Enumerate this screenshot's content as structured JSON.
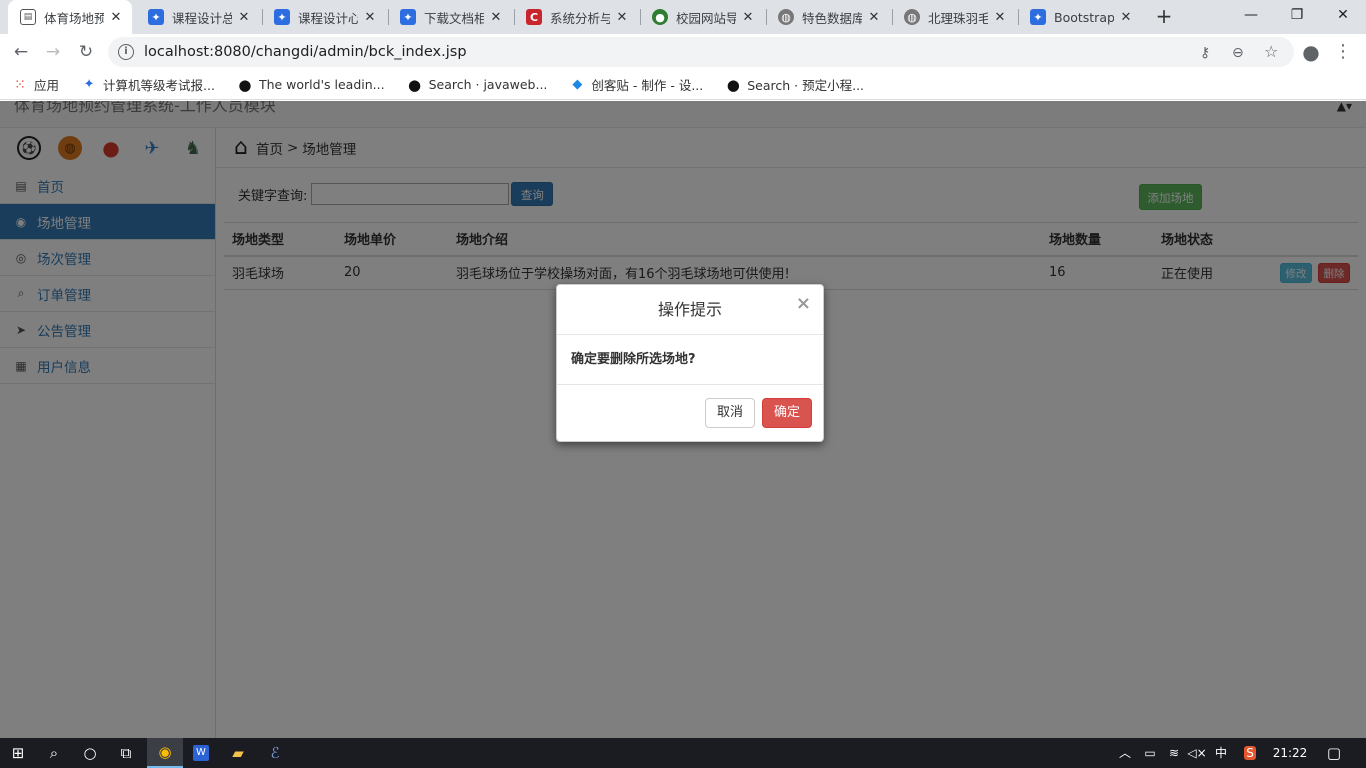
{
  "browser": {
    "tabs": [
      {
        "title": "体育场地预",
        "favicon": "page-icon",
        "active": true
      },
      {
        "title": "课程设计总",
        "favicon": "baidu-paw-icon",
        "active": false
      },
      {
        "title": "课程设计心",
        "favicon": "baidu-paw-icon",
        "active": false
      },
      {
        "title": "下载文档相",
        "favicon": "baidu-paw-icon",
        "active": false
      },
      {
        "title": "系统分析与",
        "favicon": "csdn-icon",
        "active": false
      },
      {
        "title": "校园网站导",
        "favicon": "campus-icon",
        "active": false
      },
      {
        "title": "特色数据库",
        "favicon": "globe-icon",
        "active": false
      },
      {
        "title": "北理珠羽毛",
        "favicon": "globe-icon",
        "active": false
      },
      {
        "title": "Bootstrap",
        "favicon": "baidu-paw-icon",
        "active": false
      }
    ],
    "new_tab": "+",
    "window_controls": {
      "minimize": "—",
      "restore": "❐",
      "close": "✕"
    },
    "url": "localhost:8080/changdi/admin/bck_index.jsp",
    "bookmarks": [
      {
        "label": "应用",
        "icon": "apps-grid-icon"
      },
      {
        "label": "计算机等级考试报...",
        "icon": "baidu-paw-icon"
      },
      {
        "label": "The world's leadin...",
        "icon": "github-icon"
      },
      {
        "label": "Search · javaweb...",
        "icon": "github-icon"
      },
      {
        "label": "创客贴 - 制作 - 设...",
        "icon": "chuangke-icon"
      },
      {
        "label": "Search · 预定小程...",
        "icon": "github-icon"
      }
    ]
  },
  "app": {
    "title": "体育场地预约管理系统-工作人员模块",
    "sport_icons": [
      "soccer-ball-icon",
      "basketball-icon",
      "ping-pong-icon",
      "badminton-icon",
      "sports-other-icon"
    ],
    "menu": [
      {
        "label": "首页",
        "icon": "dashboard-icon",
        "active": false
      },
      {
        "label": "场地管理",
        "icon": "venue-icon",
        "active": true
      },
      {
        "label": "场次管理",
        "icon": "check-circle-icon",
        "active": false
      },
      {
        "label": "订单管理",
        "icon": "search-icon",
        "active": false
      },
      {
        "label": "公告管理",
        "icon": "send-icon",
        "active": false
      },
      {
        "label": "用户信息",
        "icon": "user-info-icon",
        "active": false
      }
    ],
    "breadcrumb": {
      "home": "首页",
      "sep": ">",
      "current": "场地管理"
    },
    "search": {
      "label": "关键字查询:",
      "value": "",
      "button": "查询"
    },
    "add_button": "添加场地",
    "table": {
      "headers": [
        "场地类型",
        "场地单价",
        "场地介绍",
        "场地数量",
        "场地状态"
      ],
      "rows": [
        {
          "type": "羽毛球场",
          "price": "20",
          "intro": "羽毛球场位于学校操场对面，有16个羽毛球场地可供使用!",
          "count": "16",
          "status": "正在使用",
          "edit": "修改",
          "delete": "删除"
        }
      ]
    }
  },
  "modal": {
    "title": "操作提示",
    "close": "×",
    "message": "确定要删除所选场地?",
    "cancel": "取消",
    "confirm": "确定"
  },
  "taskbar": {
    "ime": "中",
    "clock": "21:22"
  }
}
